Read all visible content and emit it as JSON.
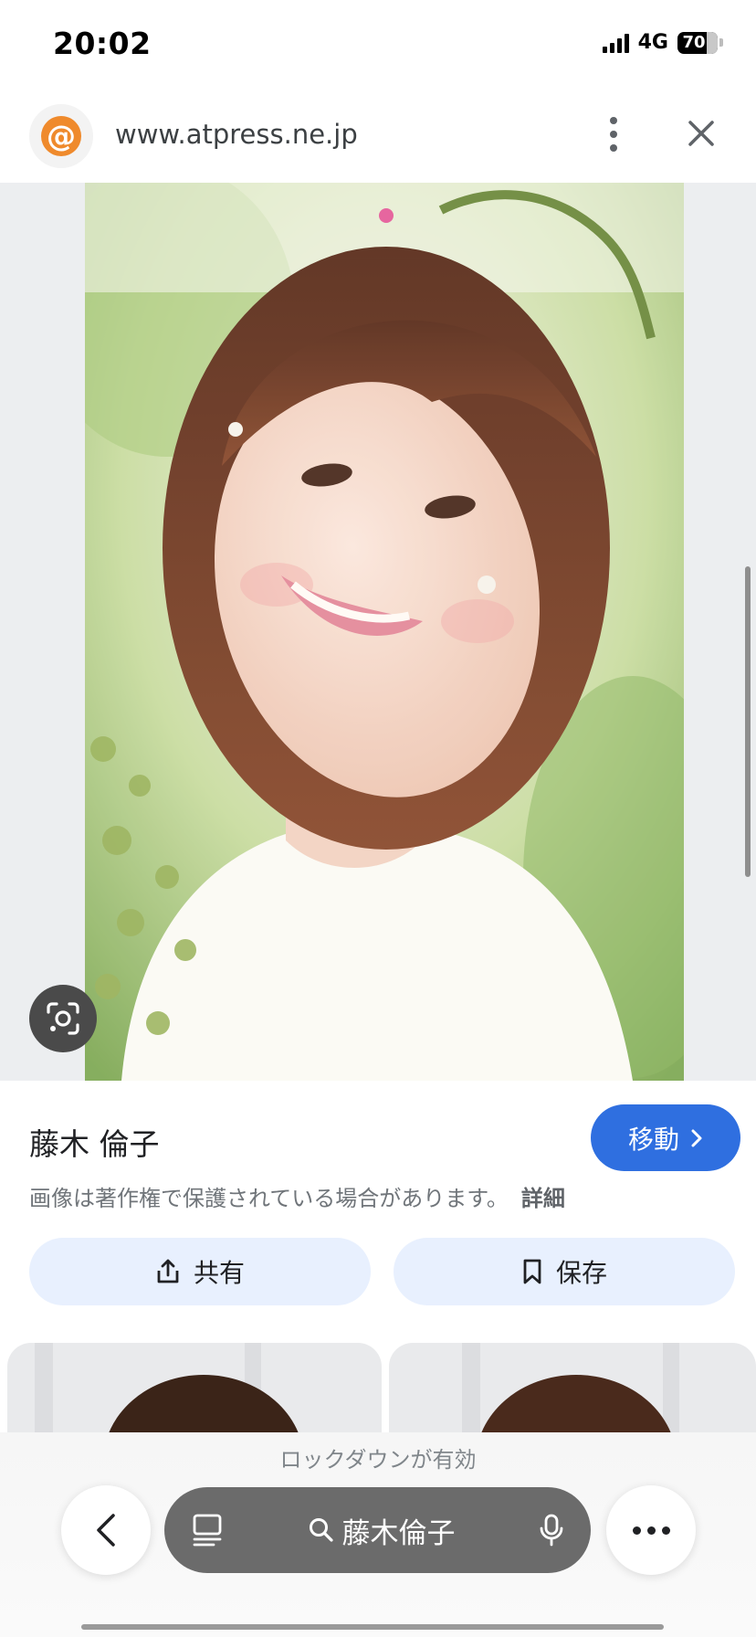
{
  "status_bar": {
    "time": "20:02",
    "network": "4G",
    "battery": "70"
  },
  "browser": {
    "favicon_glyph": "@",
    "url": "www.atpress.ne.jp"
  },
  "result": {
    "title": "藤木 倫子",
    "goto_label": "移動",
    "copyright_notice": "画像は著作権で保護されている場合があります。",
    "details_link": "詳細",
    "share_label": "共有",
    "save_label": "保存"
  },
  "footer": {
    "lockdown_text": "ロックダウンが有効",
    "search_query": "藤木倫子"
  },
  "colors": {
    "accent": "#2f6fe0",
    "action_bg": "#e8f0fe",
    "favicon": "#ef8a2c",
    "pill": "#6b6b6b"
  }
}
